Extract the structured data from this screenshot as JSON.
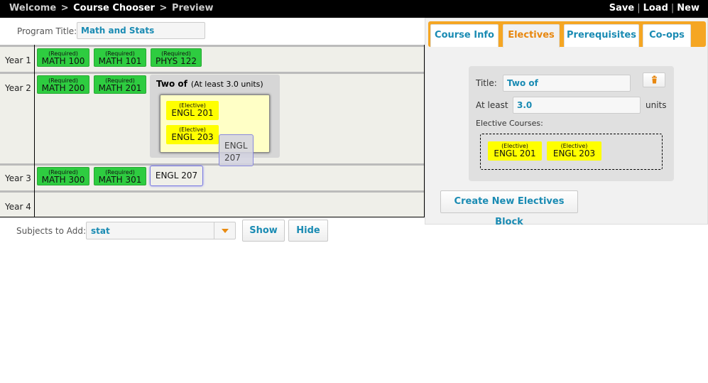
{
  "topbar": {
    "crumbs": [
      "Welcome",
      "Course Chooser",
      "Preview"
    ],
    "separator": ">",
    "actions": [
      "Save",
      "Load",
      "New"
    ]
  },
  "program": {
    "label": "Program Title:",
    "value": "Math and Stats"
  },
  "years": [
    {
      "label": "Year 1",
      "courses": [
        {
          "tag": "(Required)",
          "code": "MATH 100"
        },
        {
          "tag": "(Required)",
          "code": "MATH 101"
        },
        {
          "tag": "(Required)",
          "code": "PHYS 122"
        }
      ]
    },
    {
      "label": "Year 2",
      "courses": [
        {
          "tag": "(Required)",
          "code": "MATH 200"
        },
        {
          "tag": "(Required)",
          "code": "MATH 201"
        }
      ],
      "group": {
        "title": "Two of",
        "note": "(At least 3.0 units)",
        "courses": [
          {
            "tag": "(Elective)",
            "code": "ENGL 201"
          },
          {
            "tag": "(Elective)",
            "code": "ENGL 203"
          }
        ]
      }
    },
    {
      "label": "Year 3",
      "courses": [
        {
          "tag": "(Required)",
          "code": "MATH 300"
        },
        {
          "tag": "(Required)",
          "code": "MATH 301"
        }
      ],
      "placeholder": "ENGL 207"
    },
    {
      "label": "Year 4",
      "courses": []
    }
  ],
  "drag_ghost": {
    "line1": "ENGL",
    "line2": "207"
  },
  "subjects": {
    "label": "Subjects to Add:",
    "value": "stat",
    "show": "Show",
    "hide": "Hide"
  },
  "tabs": [
    {
      "label": "Course Info",
      "active": false
    },
    {
      "label": "Electives",
      "active": true
    },
    {
      "label": "Prerequisites",
      "active": false
    },
    {
      "label": "Co-ops",
      "active": false
    }
  ],
  "editor": {
    "title_label": "Title:",
    "title_value": "Two of",
    "atleast_label": "At least",
    "atleast_value": "3.0",
    "units_label": "units",
    "courses_label": "Elective Courses:",
    "courses": [
      {
        "tag": "(Elective)",
        "code": "ENGL 201"
      },
      {
        "tag": "(Elective)",
        "code": "ENGL 203"
      }
    ],
    "create_button": "Create New Electives Block"
  },
  "colors": {
    "required": "#2ecc40",
    "elective": "#ffff00",
    "accent": "#f5a623",
    "link": "#1a8bb3"
  }
}
